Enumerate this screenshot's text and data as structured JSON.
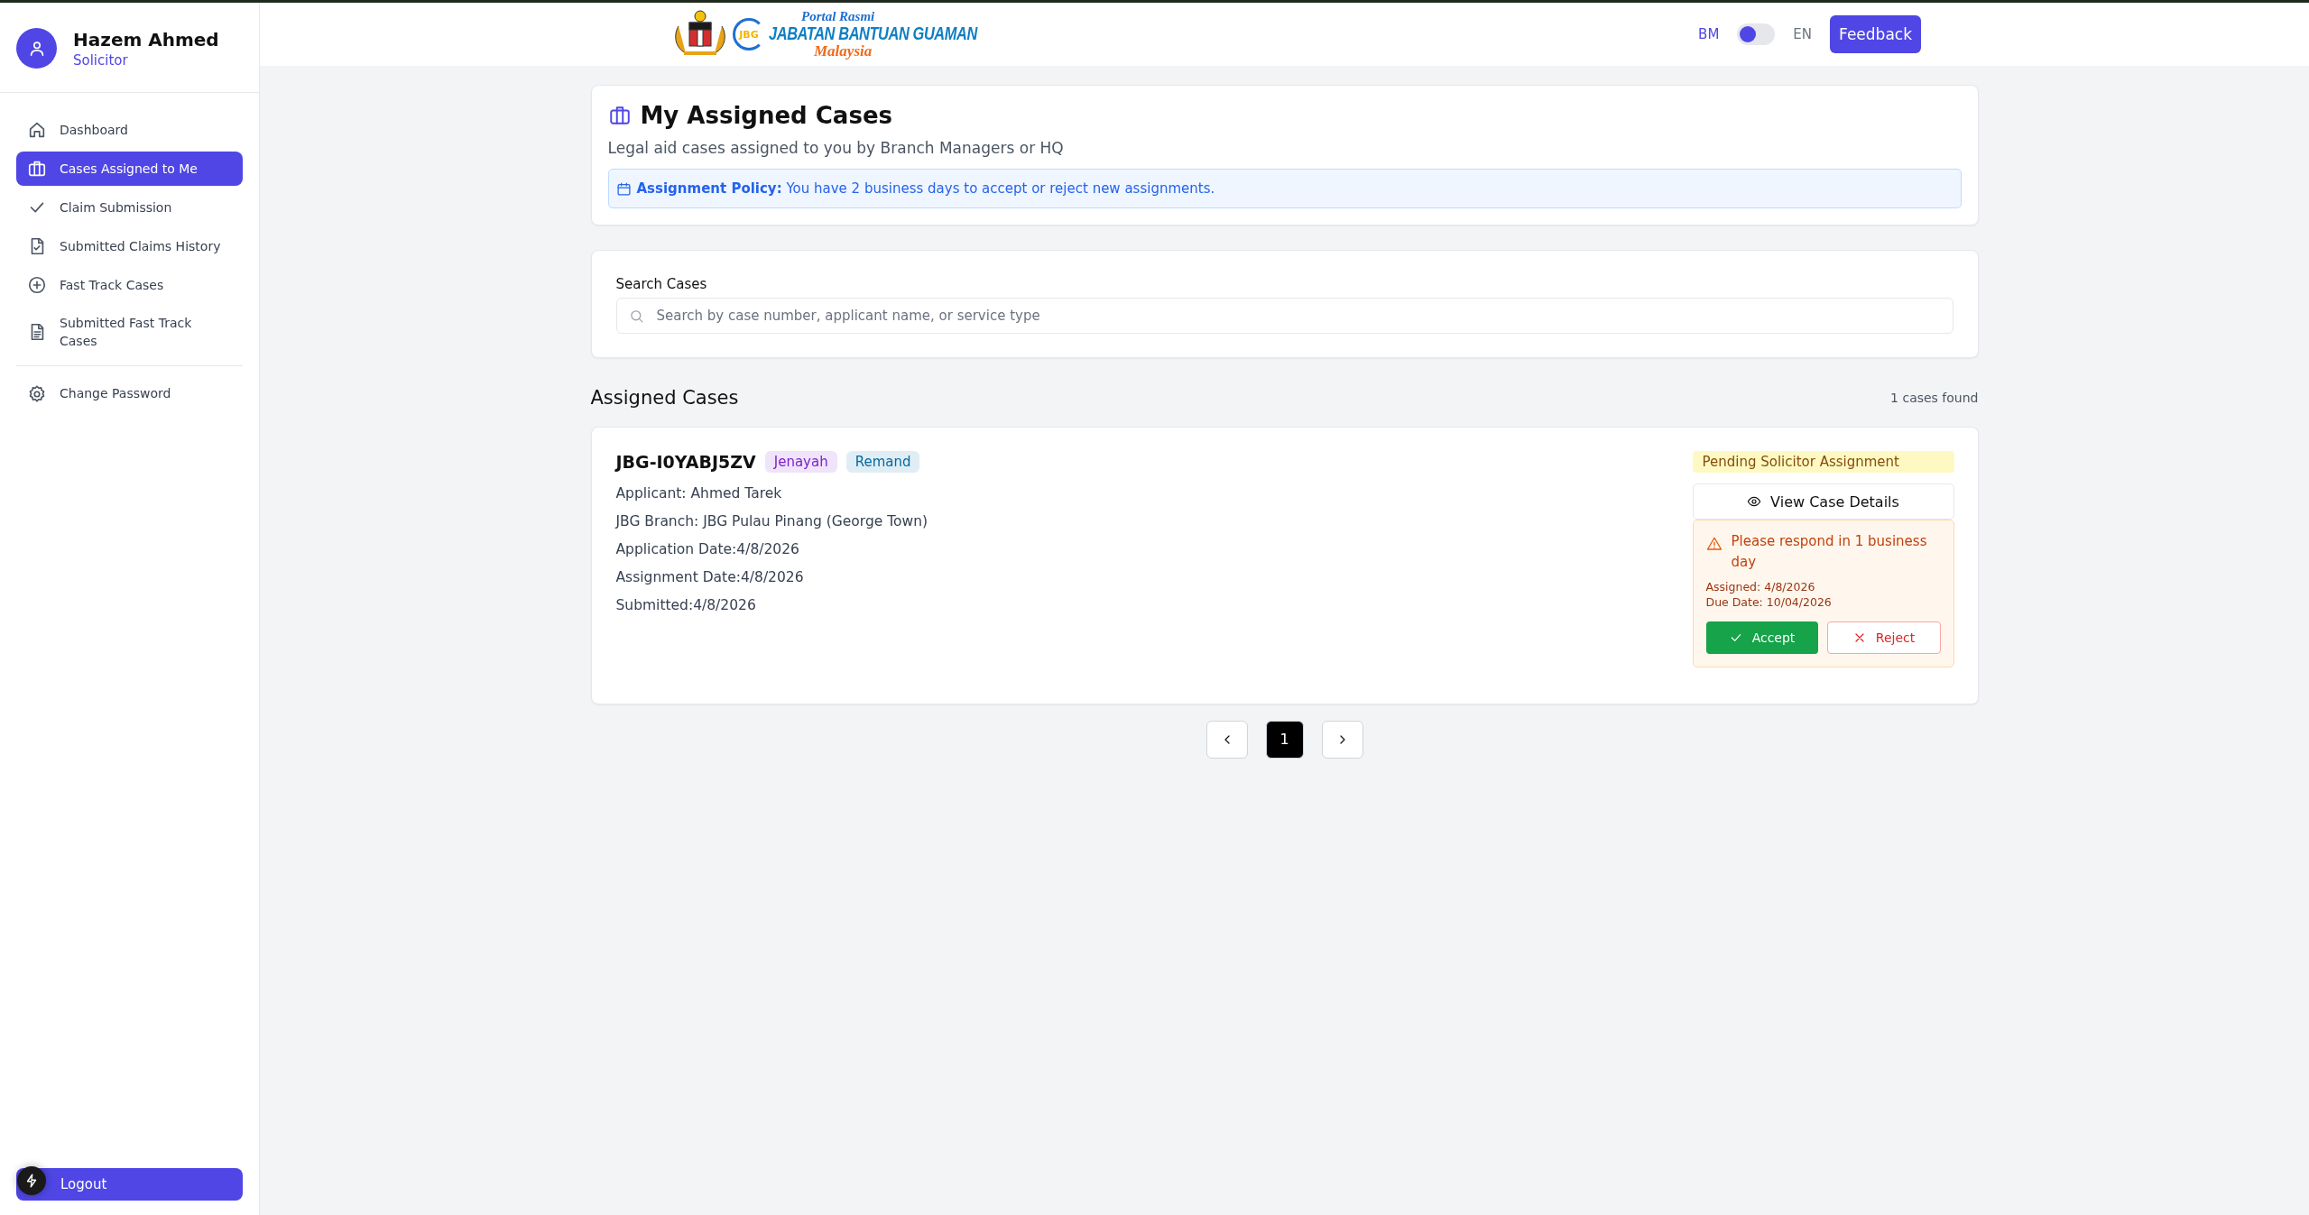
{
  "user": {
    "name": "Hazem Ahmed",
    "role": "Solicitor"
  },
  "sidebar": {
    "sections": [
      [
        {
          "label": "Dashboard",
          "selected": false
        },
        {
          "label": "Cases Assigned to Me",
          "selected": true
        },
        {
          "label": "Claim Submission",
          "selected": false
        },
        {
          "label": "Submitted Claims History",
          "selected": false
        },
        {
          "label": "Fast Track Cases",
          "selected": false
        },
        {
          "label": "Submitted Fast Track Cases",
          "selected": false
        }
      ],
      [
        {
          "label": "Change Password",
          "selected": false
        }
      ]
    ],
    "logout": "Logout"
  },
  "header": {
    "logo": {
      "mark": "JBG",
      "line_1": "Portal Rasmi",
      "line_2": "JABATAN BANTUAN GUAMAN",
      "line_3": "Malaysia"
    },
    "languages": [
      {
        "label": "BM",
        "selected": true
      },
      {
        "label": "EN",
        "selected": false
      }
    ],
    "feedback": "Feedback"
  },
  "page": {
    "title": "My Assigned Cases",
    "subtitle": "Legal aid cases assigned to you by Branch Managers or HQ",
    "policy": "**Assignment Policy:** You have 2 business days to accept or reject new assignments."
  },
  "search": {
    "label": "Search Cases",
    "placeholder": "Search by case number, applicant name, or service type"
  },
  "results": {
    "heading": "Assigned Cases",
    "count": "1 cases found"
  },
  "cases": [
    {
      "number": "JBG-I0YABJ5ZV",
      "tags": [
        {
          "label": "Jenayah",
          "color": "#7e22ce"
        },
        {
          "label": "Remand",
          "color": "#0369a1"
        }
      ],
      "details": [
        "Applicant: Ahmed Tarek",
        "JBG Branch: JBG Pulau Pinang (George Town)",
        "Application Date:4/8/2026",
        "Assignment Date:4/8/2026",
        "Submitted:4/8/2026"
      ],
      "status": "Pending Solicitor Assignment",
      "view": "View Case Details",
      "warning": "Please respond in 1 business day",
      "assigned": "Assigned: 4/8/2026",
      "due": "Due Date: 10/04/2026",
      "accept": "Accept",
      "reject": "Reject"
    }
  ],
  "pagination": {
    "pages": [
      {
        "label": "1",
        "selected": true
      }
    ]
  }
}
